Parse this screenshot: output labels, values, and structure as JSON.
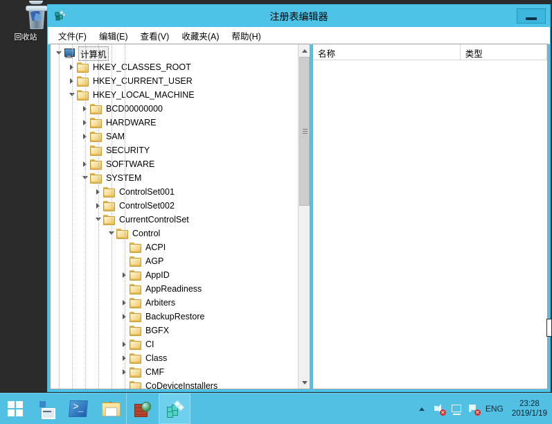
{
  "desktop": {
    "recycle_bin_label": "回收站",
    "background_color": "#2b2b2b"
  },
  "window": {
    "title": "注册表编辑器",
    "accent_color": "#4dc3e8",
    "app_icon": "registry-editor-icon",
    "minimize_label": "–",
    "menu": [
      {
        "label": "文件(F)"
      },
      {
        "label": "编辑(E)"
      },
      {
        "label": "查看(V)"
      },
      {
        "label": "收藏夹(A)"
      },
      {
        "label": "帮助(H)"
      }
    ]
  },
  "tree": {
    "nodes": [
      {
        "label": "计算机",
        "depth": 0,
        "state": "expanded",
        "icon": "computer-icon",
        "selected": true
      },
      {
        "label": "HKEY_CLASSES_ROOT",
        "depth": 1,
        "state": "collapsed",
        "icon": "folder-icon",
        "selected": false
      },
      {
        "label": "HKEY_CURRENT_USER",
        "depth": 1,
        "state": "collapsed",
        "icon": "folder-icon",
        "selected": false
      },
      {
        "label": "HKEY_LOCAL_MACHINE",
        "depth": 1,
        "state": "expanded",
        "icon": "folder-icon",
        "selected": false
      },
      {
        "label": "BCD00000000",
        "depth": 2,
        "state": "collapsed",
        "icon": "folder-icon",
        "selected": false
      },
      {
        "label": "HARDWARE",
        "depth": 2,
        "state": "collapsed",
        "icon": "folder-icon",
        "selected": false
      },
      {
        "label": "SAM",
        "depth": 2,
        "state": "collapsed",
        "icon": "folder-icon",
        "selected": false
      },
      {
        "label": "SECURITY",
        "depth": 2,
        "state": "leaf",
        "icon": "folder-icon",
        "selected": false
      },
      {
        "label": "SOFTWARE",
        "depth": 2,
        "state": "collapsed",
        "icon": "folder-icon",
        "selected": false
      },
      {
        "label": "SYSTEM",
        "depth": 2,
        "state": "expanded",
        "icon": "folder-icon",
        "selected": false
      },
      {
        "label": "ControlSet001",
        "depth": 3,
        "state": "collapsed",
        "icon": "folder-icon",
        "selected": false
      },
      {
        "label": "ControlSet002",
        "depth": 3,
        "state": "collapsed",
        "icon": "folder-icon",
        "selected": false
      },
      {
        "label": "CurrentControlSet",
        "depth": 3,
        "state": "expanded",
        "icon": "folder-icon",
        "selected": false
      },
      {
        "label": "Control",
        "depth": 4,
        "state": "expanded",
        "icon": "folder-icon",
        "selected": false
      },
      {
        "label": "ACPI",
        "depth": 5,
        "state": "leaf",
        "icon": "folder-icon",
        "selected": false
      },
      {
        "label": "AGP",
        "depth": 5,
        "state": "leaf",
        "icon": "folder-icon",
        "selected": false
      },
      {
        "label": "AppID",
        "depth": 5,
        "state": "collapsed",
        "icon": "folder-icon",
        "selected": false
      },
      {
        "label": "AppReadiness",
        "depth": 5,
        "state": "leaf",
        "icon": "folder-icon",
        "selected": false
      },
      {
        "label": "Arbiters",
        "depth": 5,
        "state": "collapsed",
        "icon": "folder-icon",
        "selected": false
      },
      {
        "label": "BackupRestore",
        "depth": 5,
        "state": "collapsed",
        "icon": "folder-icon",
        "selected": false
      },
      {
        "label": "BGFX",
        "depth": 5,
        "state": "leaf",
        "icon": "folder-icon",
        "selected": false
      },
      {
        "label": "CI",
        "depth": 5,
        "state": "collapsed",
        "icon": "folder-icon",
        "selected": false
      },
      {
        "label": "Class",
        "depth": 5,
        "state": "collapsed",
        "icon": "folder-icon",
        "selected": false
      },
      {
        "label": "CMF",
        "depth": 5,
        "state": "collapsed",
        "icon": "folder-icon",
        "selected": false
      },
      {
        "label": "CoDeviceInstallers",
        "depth": 5,
        "state": "leaf",
        "icon": "folder-icon",
        "selected": false
      }
    ]
  },
  "value_pane": {
    "columns": [
      {
        "label": "名称"
      },
      {
        "label": "类型"
      }
    ],
    "rows": []
  },
  "taskbar": {
    "start_icon": "windows-start-icon",
    "buttons": [
      {
        "icon": "server-manager-icon",
        "name": "server-manager"
      },
      {
        "icon": "powershell-icon",
        "name": "powershell"
      },
      {
        "icon": "file-explorer-icon",
        "name": "file-explorer"
      },
      {
        "icon": "firewall-icon",
        "name": "windows-firewall"
      },
      {
        "icon": "registry-editor-icon",
        "name": "registry-editor",
        "active": true
      }
    ],
    "tray": {
      "show_hidden_icon": "chevron-up-icon",
      "volume_icon": "speaker-muted-icon",
      "network_icon": "network-icon",
      "action_center_icon": "flag-error-icon",
      "language": "ENG",
      "time": "23:28",
      "date": "2019/1/19"
    }
  }
}
